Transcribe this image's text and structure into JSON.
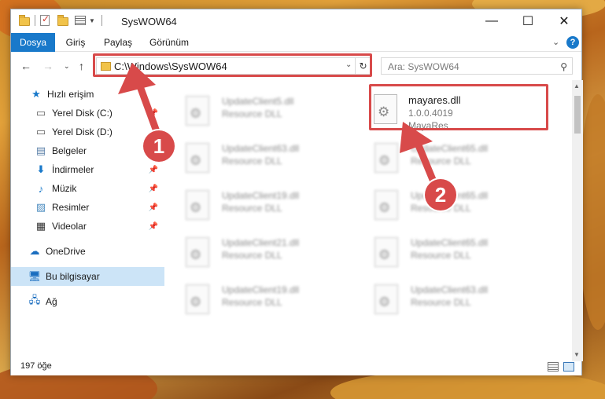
{
  "window": {
    "title": "SysWOW64"
  },
  "ribbon": {
    "tabs": [
      {
        "label": "Dosya"
      },
      {
        "label": "Giriş"
      },
      {
        "label": "Paylaş"
      },
      {
        "label": "Görünüm"
      }
    ]
  },
  "nav": {
    "address": "C:\\Windows\\SysWOW64",
    "search_placeholder": "Ara: SysWOW64"
  },
  "sidebar": {
    "items": [
      {
        "label": "Hızlı erişim",
        "icon": "star-icon"
      },
      {
        "label": "Yerel Disk (C:)",
        "icon": "drive-icon"
      },
      {
        "label": "Yerel Disk (D:)",
        "icon": "drive-icon"
      },
      {
        "label": "Belgeler",
        "icon": "documents-icon"
      },
      {
        "label": "İndirmeler",
        "icon": "download-icon"
      },
      {
        "label": "Müzik",
        "icon": "music-icon"
      },
      {
        "label": "Resimler",
        "icon": "pictures-icon"
      },
      {
        "label": "Videolar",
        "icon": "videos-icon"
      },
      {
        "label": "OneDrive",
        "icon": "cloud-icon"
      },
      {
        "label": "Bu bilgisayar",
        "icon": "computer-icon"
      },
      {
        "label": "Ağ",
        "icon": "network-icon"
      }
    ]
  },
  "files": {
    "left": [
      {
        "name": "UpdateClient5.dll",
        "type": "Resource DLL"
      },
      {
        "name": "UpdateClient63.dll",
        "type": "Resource DLL"
      },
      {
        "name": "UpdateClient19.dll",
        "type": "Resource DLL"
      },
      {
        "name": "UpdateClient21.dll",
        "type": "Resource DLL"
      },
      {
        "name": "UpdateClient19.dll",
        "type": "Resource DLL"
      }
    ],
    "right": [
      {
        "name": "mayares.dll",
        "version": "1.0.0.4019",
        "company": "MayaRes"
      },
      {
        "name": "UpdateClient65.dll",
        "type": "Resource DLL"
      },
      {
        "name": "UpdateClient65.dll",
        "type": "Resource DLL"
      },
      {
        "name": "UpdateClient65.dll",
        "type": "Resource DLL"
      },
      {
        "name": "UpdateClient63.dll",
        "type": "Resource DLL"
      }
    ]
  },
  "status": {
    "count": "197 öğe"
  },
  "annotations": {
    "badge1": "1",
    "badge2": "2",
    "color": "#d84a4a"
  }
}
